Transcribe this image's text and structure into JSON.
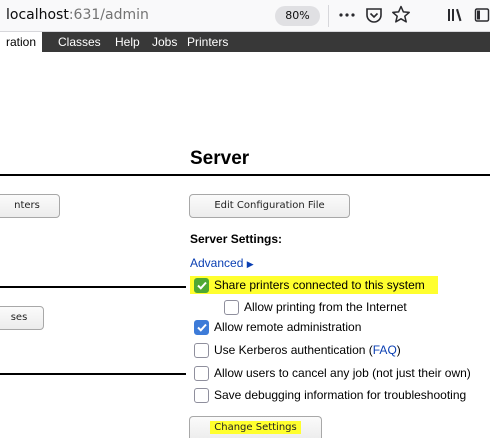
{
  "browser": {
    "url_host": "localhost",
    "url_path": ":631/admin",
    "zoom": "80%",
    "icons": [
      "more-icon",
      "pocket-icon",
      "bookmark-star-icon",
      "library-icon",
      "sidebar-icon"
    ]
  },
  "nav": {
    "items": [
      {
        "label": "ration",
        "active": true
      },
      {
        "label": "Classes",
        "active": false
      },
      {
        "label": "Help",
        "active": false
      },
      {
        "label": "Jobs",
        "active": false
      },
      {
        "label": "Printers",
        "active": false
      }
    ]
  },
  "left": {
    "button1_label": "nters",
    "button2_label": "ses"
  },
  "server": {
    "title": "Server",
    "edit_config_label": "Edit Configuration File",
    "settings_label": "Server Settings:",
    "advanced_label": "Advanced",
    "options": [
      {
        "label": "Share printers connected to this system",
        "checked": true,
        "highlighted": true
      },
      {
        "label": "Allow printing from the Internet",
        "checked": false,
        "highlighted": false
      },
      {
        "label": "Allow remote administration",
        "checked": true,
        "highlighted": false
      },
      {
        "label": "Use Kerberos authentication (",
        "link": "FAQ",
        "suffix": ")",
        "checked": false,
        "highlighted": false
      },
      {
        "label": "Allow users to cancel any job (not just their own)",
        "checked": false,
        "highlighted": false
      },
      {
        "label": "Save debugging information for troubleshooting",
        "checked": false,
        "highlighted": false
      }
    ],
    "change_settings_label": "Change Settings"
  },
  "colors": {
    "highlight": "#ffff2e",
    "link": "#0a3fb3",
    "navbar": "#383838",
    "checkbox_checked": "#3d7bd8",
    "checkbox_green": "#4fa832"
  }
}
